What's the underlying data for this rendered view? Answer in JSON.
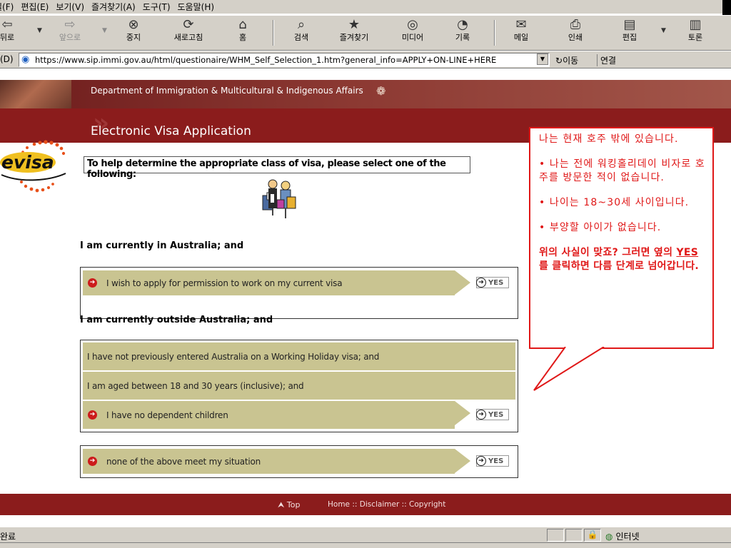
{
  "menubar": {
    "items": [
      "일(F)",
      "편집(E)",
      "보기(V)",
      "즐겨찾기(A)",
      "도구(T)",
      "도움말(H)"
    ]
  },
  "toolbar": {
    "back": "뒤로",
    "forward": "앞으로",
    "stop": "중지",
    "refresh": "새로고침",
    "home": "홈",
    "search": "검색",
    "favorites": "즐겨찾기",
    "media": "미디어",
    "history": "기록",
    "mail": "메일",
    "print": "인쇄",
    "edit": "편집",
    "discuss": "토론"
  },
  "addressbar": {
    "label": "(D)",
    "url": "https://www.sip.immi.gov.au/html/questionaire/WHM_Self_Selection_1.htm?general_info=APPLY+ON-LINE+HERE",
    "go": "이동",
    "links": "연결"
  },
  "header": {
    "department": "Department of Immigration & Multicultural & Indigenous Affairs",
    "app_title": "Electronic Visa Application",
    "logo_text": "evisa"
  },
  "main": {
    "instruction": "To help determine the appropriate class of visa, please select one of the following:",
    "section_in": "I am currently in Australia; and",
    "option_in": "I wish to apply for permission to work on my current visa",
    "section_out": "I am currently outside Australia; and",
    "option_out_1": "I have not previously entered Australia on a Working Holiday visa; and",
    "option_out_2": "I am aged between 18 and 30 years (inclusive); and",
    "option_out_3": "I have no dependent children",
    "option_none": "none of the above meet my situation",
    "yes_label": "YES"
  },
  "footer": {
    "top": "Top",
    "links": "Home :: Disclaimer :: Copyright"
  },
  "statusbar": {
    "status": "완료",
    "zone": "인터넷"
  },
  "callout": {
    "line1": "나는 현재 호주 밖에 있습니다.",
    "line2": "• 나는 전에 워킹홀리데이 비자로 호주를 방문한 적이 없습니다.",
    "line3": "• 나이는 18~30세 사이입니다.",
    "line4": "• 부양할 아이가 없습니다.",
    "line5_a": "위의 사실이 맞죠? 그러면 옆의 ",
    "line5_yes": "YES",
    "line5_b": " 를 클릭하면 다름 단계로 넘어갑니다."
  },
  "colors": {
    "header_maroon": "#8b1c1c",
    "option_khaki": "#c9c491",
    "callout_red": "#e01818"
  }
}
